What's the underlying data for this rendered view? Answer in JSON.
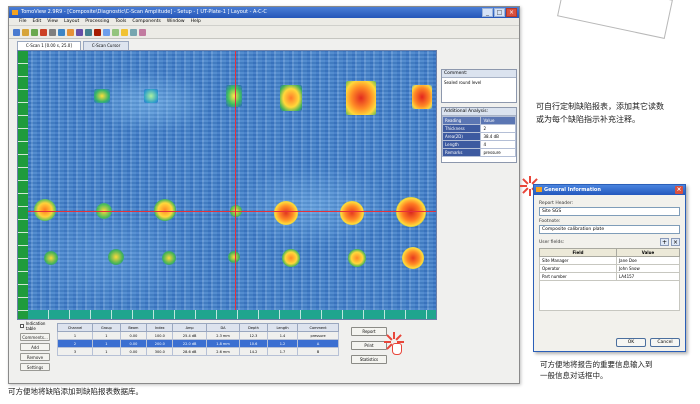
{
  "app": {
    "title": "TomoView 2.9R9 - [Composite\\Diagnostic\\C-Scan Amplitude] - Setup - [ UT-Plate-1 ] Layout - A-C-C",
    "menu": [
      "File",
      "Edit",
      "View",
      "Layout",
      "Processing",
      "Tools",
      "Components",
      "Window",
      "Help"
    ],
    "toolbar_colors": [
      "#4a7bd0",
      "#d6a43a",
      "#6aa84f",
      "#cc4125",
      "#7f7f7f",
      "#3d85c6",
      "#e69138",
      "#674ea7",
      "#45818e",
      "#a61c00",
      "#6d9eeb",
      "#93c47d",
      "#f1c232",
      "#76a5af",
      "#c27ba0"
    ],
    "scan_tabs": [
      "C-Scan 1 [0.00 s, 25.0]",
      "C-Scan Cursor"
    ]
  },
  "comment_panel": {
    "header": "Comment:",
    "text": "Sealed round level"
  },
  "additional_analysis": {
    "header": "Additional Analysis:",
    "columns": [
      "Reading",
      "Value"
    ],
    "rows": [
      {
        "k": "Reading",
        "v": "Value"
      },
      {
        "k": "Thickness",
        "v": "2"
      },
      {
        "k": "Area(2D)",
        "v": "38.4 dB"
      },
      {
        "k": "Length",
        "v": "4"
      },
      {
        "k": "Remarks",
        "v": "pressure"
      }
    ]
  },
  "bottom": {
    "check_label": "Indication table",
    "side_buttons": [
      "Comments...",
      "Add",
      "Remove",
      "Settings"
    ],
    "table_headers": [
      "Channel",
      "Group",
      "Beam",
      "Index",
      "Amp",
      "DA",
      "Depth",
      "Length",
      "Comment"
    ],
    "table_rows": [
      [
        "1",
        "1",
        "0.00",
        "100.0",
        "25.4 dB",
        "2.3 mm",
        "12.3",
        "1.4",
        "pressure"
      ],
      [
        "2",
        "1",
        "0.00",
        "200.0",
        "22.0 dB",
        "1.8 mm",
        "10.6",
        "1.2",
        "A"
      ],
      [
        "3",
        "1",
        "0.00",
        "300.0",
        "28.6 dB",
        "2.6 mm",
        "14.2",
        "1.7",
        "B"
      ]
    ],
    "action_buttons": [
      "Report",
      "Print",
      "Statistics"
    ]
  },
  "annotations": {
    "right_note_line1": "可自行定制缺陷报表，添加其它读数",
    "right_note_line2": "或为每个缺陷指示补充注释。",
    "dialog_note_line1": "可方便地将报告的重要信息输入到",
    "dialog_note_line2": "一般信息对话框中。",
    "bottom_note": "可方便地将缺陷添加到缺陷报表数据库。"
  },
  "dialog": {
    "title": "General Information",
    "report_header_label": "Report Header:",
    "report_header_value": "Site SGS",
    "footnote_label": "Footnote:",
    "footnote_value": "Composite calibration plate",
    "user_fields_label": "User fields:",
    "add_icon": "+",
    "remove_icon": "×",
    "columns": [
      "Field",
      "Value"
    ],
    "rows": [
      {
        "field": "Site Manager",
        "value": "Jane Doe"
      },
      {
        "field": "Operator",
        "value": "John Snow"
      },
      {
        "field": "Part number",
        "value": "LA4157"
      }
    ],
    "ok_label": "OK",
    "cancel_label": "Cancel"
  }
}
